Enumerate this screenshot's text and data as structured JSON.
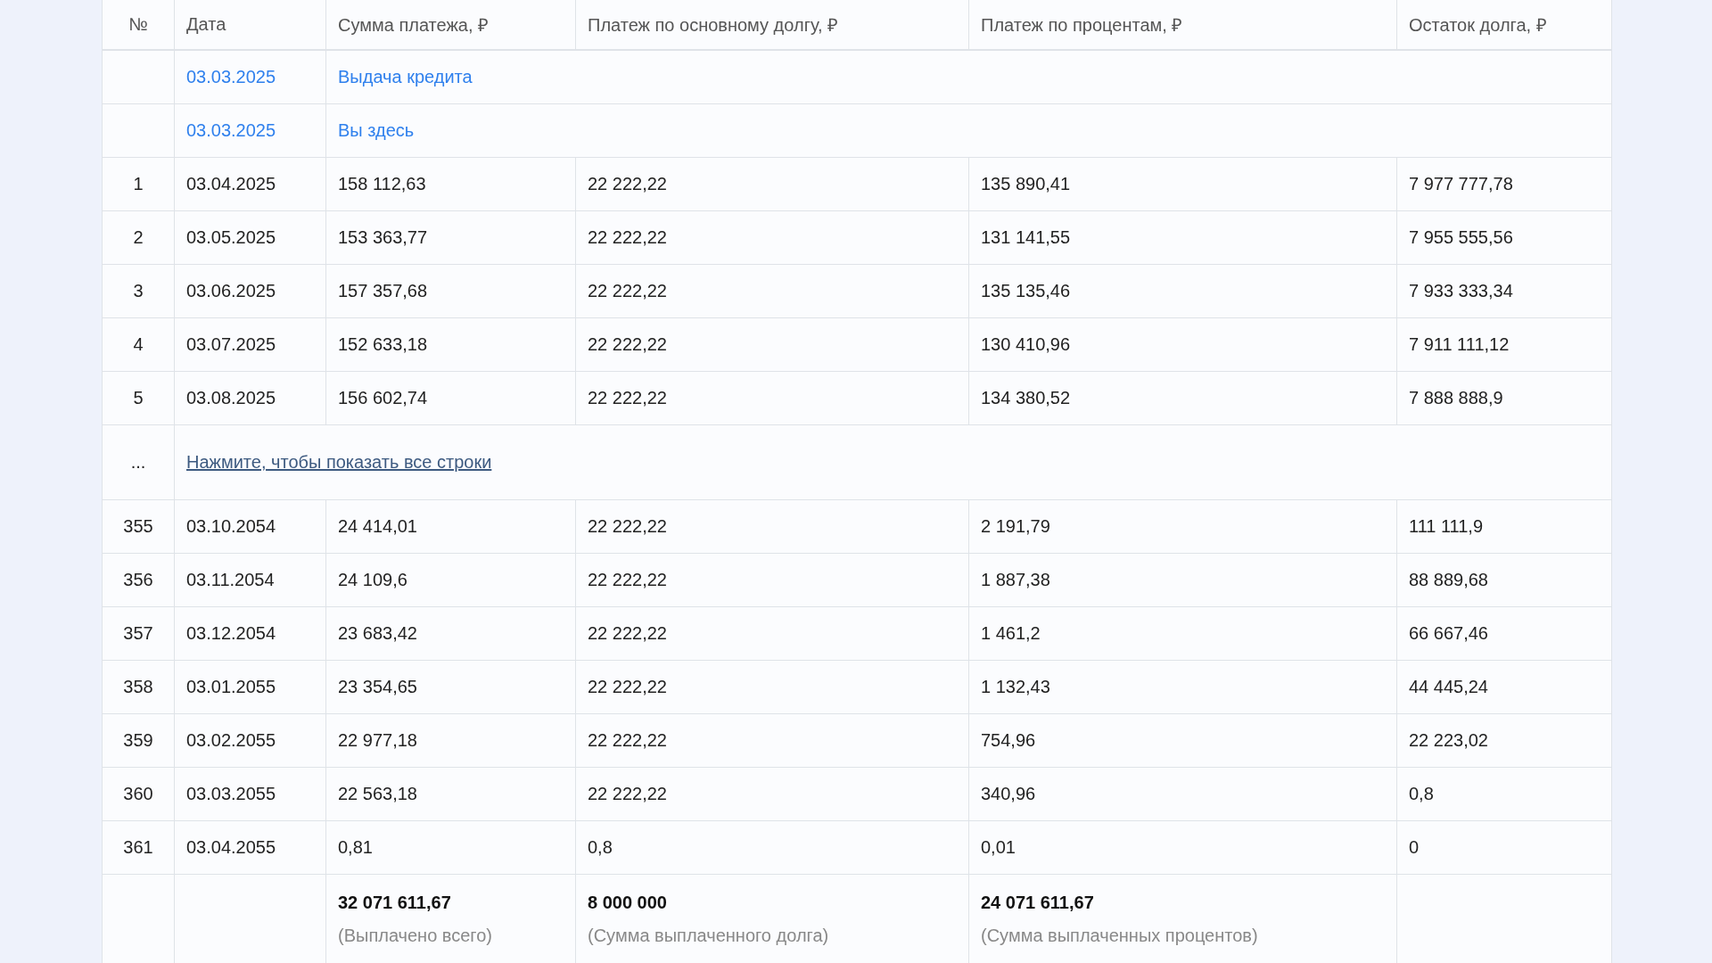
{
  "table": {
    "columns": [
      "№",
      "Дата",
      "Сумма платежа, ₽",
      "Платеж по основному долгу, ₽",
      "Платеж по процентам, ₽",
      "Остаток долга, ₽"
    ],
    "rows": [
      {
        "kind": "event",
        "date": "03.03.2025",
        "label": "Выдача кредита"
      },
      {
        "kind": "event",
        "date": "03.03.2025",
        "label": "Вы здесь"
      },
      {
        "kind": "payment",
        "cells": [
          "1",
          "03.04.2025",
          "158 112,63",
          "22 222,22",
          "135 890,41",
          "7 977 777,78"
        ]
      },
      {
        "kind": "payment",
        "cells": [
          "2",
          "03.05.2025",
          "153 363,77",
          "22 222,22",
          "131 141,55",
          "7 955 555,56"
        ]
      },
      {
        "kind": "payment",
        "cells": [
          "3",
          "03.06.2025",
          "157 357,68",
          "22 222,22",
          "135 135,46",
          "7 933 333,34"
        ]
      },
      {
        "kind": "payment",
        "cells": [
          "4",
          "03.07.2025",
          "152 633,18",
          "22 222,22",
          "130 410,96",
          "7 911 111,12"
        ]
      },
      {
        "kind": "payment",
        "cells": [
          "5",
          "03.08.2025",
          "156 602,74",
          "22 222,22",
          "134 380,52",
          "7 888 888,9"
        ]
      },
      {
        "kind": "expand",
        "mark": "...",
        "link": "Нажмите, чтобы показать все строки"
      },
      {
        "kind": "payment",
        "cells": [
          "355",
          "03.10.2054",
          "24 414,01",
          "22 222,22",
          "2 191,79",
          "111 111,9"
        ]
      },
      {
        "kind": "payment",
        "cells": [
          "356",
          "03.11.2054",
          "24 109,6",
          "22 222,22",
          "1 887,38",
          "88 889,68"
        ]
      },
      {
        "kind": "payment",
        "cells": [
          "357",
          "03.12.2054",
          "23 683,42",
          "22 222,22",
          "1 461,2",
          "66 667,46"
        ]
      },
      {
        "kind": "payment",
        "cells": [
          "358",
          "03.01.2055",
          "23 354,65",
          "22 222,22",
          "1 132,43",
          "44 445,24"
        ]
      },
      {
        "kind": "payment",
        "cells": [
          "359",
          "03.02.2055",
          "22 977,18",
          "22 222,22",
          "754,96",
          "22 223,02"
        ]
      },
      {
        "kind": "payment",
        "cells": [
          "360",
          "03.03.2055",
          "22 563,18",
          "22 222,22",
          "340,96",
          "0,8"
        ]
      },
      {
        "kind": "payment",
        "cells": [
          "361",
          "03.04.2055",
          "0,81",
          "0,8",
          "0,01",
          "0"
        ]
      }
    ],
    "totals": [
      {
        "value": "32 071 611,67",
        "caption": "(Выплачено всего)"
      },
      {
        "value": "8 000 000",
        "caption": "(Сумма выплаченного долга)"
      },
      {
        "value": "24 071 611,67",
        "caption": "(Сумма выплаченных процентов)"
      }
    ]
  }
}
